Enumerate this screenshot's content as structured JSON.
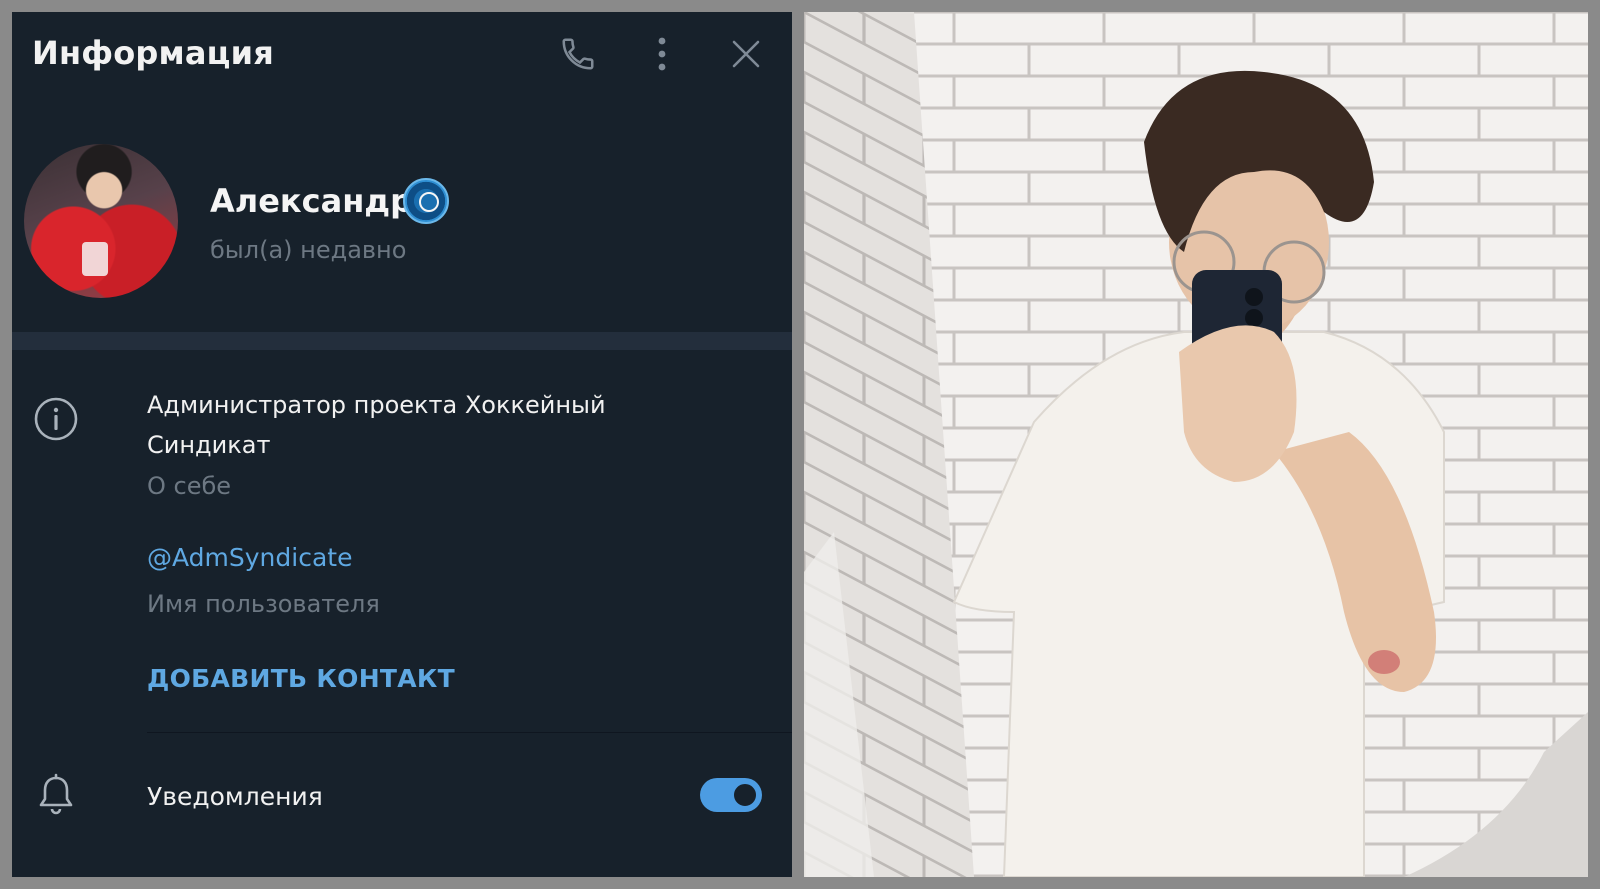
{
  "header": {
    "title": "Информация"
  },
  "profile": {
    "name": "Александр",
    "status": "был(а) недавно"
  },
  "about": {
    "text": "Администратор проекта Хоккейный Синдикат",
    "label": "О себе"
  },
  "username": {
    "value": "@AdmSyndicate",
    "label": "Имя пользователя"
  },
  "actions": {
    "add_contact": "ДОБАВИТЬ КОНТАКТ"
  },
  "notifications": {
    "label": "Уведомления",
    "enabled": true
  },
  "icons": [
    "phone-icon",
    "more-vertical-icon",
    "close-icon",
    "verified-badge-icon",
    "info-icon",
    "bell-icon"
  ],
  "colors": {
    "panel_bg": "#17212b",
    "accent": "#5fa8e2",
    "muted": "#6d7883",
    "toggle_on": "#4c9ce2"
  }
}
